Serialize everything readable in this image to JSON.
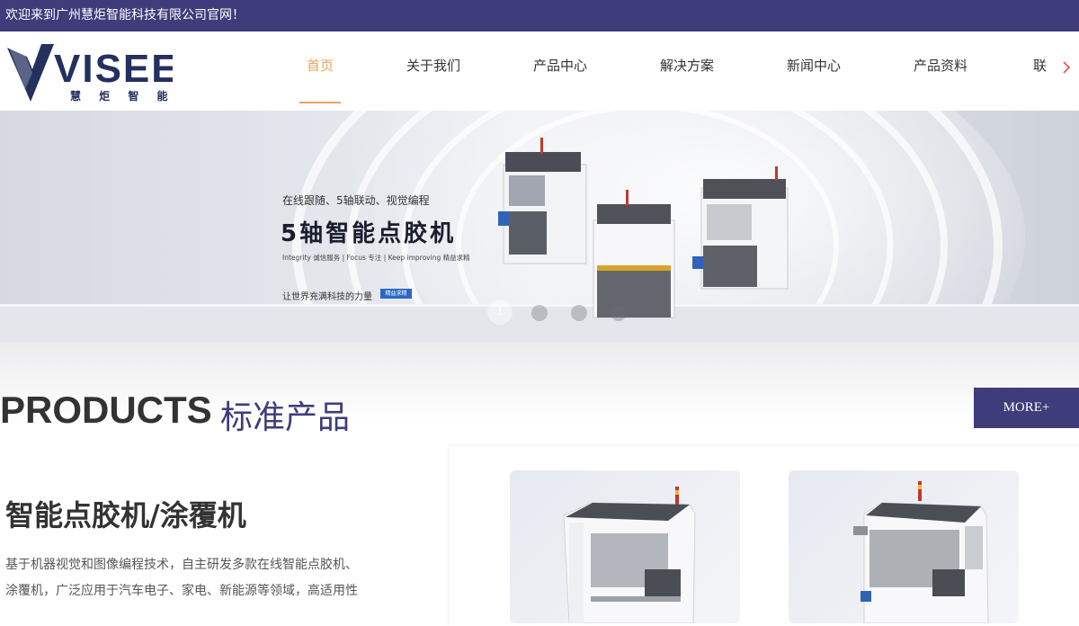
{
  "topbar": {
    "welcome": "欢迎来到广州慧炬智能科技有限公司官网！"
  },
  "logo": {
    "brand": "VISEE",
    "subtitle": "慧 炬 智 能"
  },
  "nav": {
    "items": [
      {
        "label": "首页",
        "active": true
      },
      {
        "label": "关于我们",
        "active": false
      },
      {
        "label": "产品中心",
        "active": false
      },
      {
        "label": "解决方案",
        "active": false
      },
      {
        "label": "新闻中心",
        "active": false
      },
      {
        "label": "产品资料",
        "active": false
      },
      {
        "label": "联",
        "active": false
      }
    ],
    "next_icon": "chevron-right-icon"
  },
  "banner": {
    "tagline": "在线跟随、5轴联动、视觉编程",
    "title": "5轴智能点胶机",
    "sub": "Integrity 诚信服务 | Focus 专注 | Keep improving 精益求精",
    "slogan": "让世界充满科技的力量",
    "badge": "精益求精",
    "active_slide": "1"
  },
  "products": {
    "title_en": "PRODUCTS",
    "title_cn": "标准产品",
    "more_label": "MORE+",
    "category_title": "智能点胶机/涂覆机",
    "category_desc": "基于机器视觉和图像编程技术，自主研发多款在线智能点胶机、涂覆机，广泛应用于汽车电子、家电、新能源等领域，高适用性"
  },
  "colors": {
    "brand": "#3e3c7a",
    "accent": "#e8a45c",
    "logo": "#24305e"
  }
}
